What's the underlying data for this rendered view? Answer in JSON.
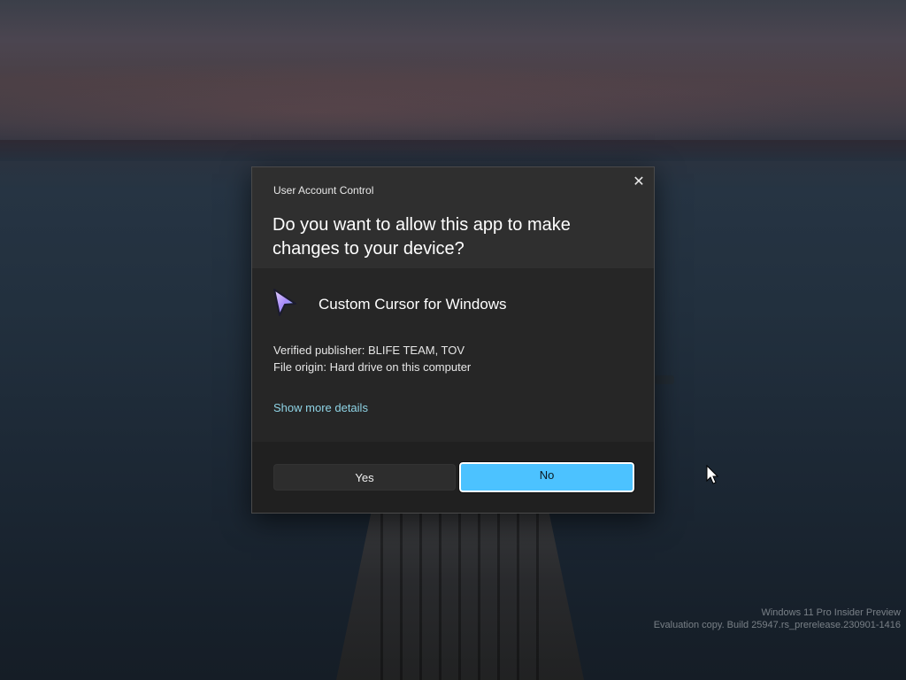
{
  "dialog": {
    "caption": "User Account Control",
    "question": "Do you want to allow this app to make changes to your device?",
    "app_name": "Custom Cursor for Windows",
    "publisher_line": "Verified publisher: BLIFE TEAM, TOV",
    "origin_line": "File origin: Hard drive on this computer",
    "details_link": "Show more details",
    "yes_label": "Yes",
    "no_label": "No",
    "close_glyph": "✕"
  },
  "watermark": {
    "line1": "Windows 11 Pro Insider Preview",
    "line2": "Evaluation copy. Build 25947.rs_prerelease.230901-1416"
  },
  "icons": {
    "app": "cursor-arrow-icon",
    "close": "close-icon",
    "pointer": "mouse-pointer-icon"
  },
  "colors": {
    "no_button": "#4cc2ff",
    "link": "#8fd4e6",
    "dialog_bg": "#2b2b2b"
  }
}
